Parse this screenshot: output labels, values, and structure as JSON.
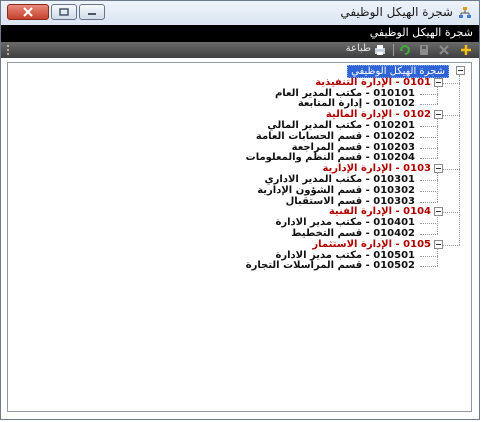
{
  "window": {
    "title": "شجرة الهيكل الوظيفي",
    "icon": "org-tree-icon"
  },
  "header": {
    "title": "شجرة الهيكل الوظيفي"
  },
  "toolbar": {
    "add_icon": "plus-icon",
    "delete_icon": "close-icon",
    "save_icon": "disk-icon",
    "refresh_icon": "refresh-icon",
    "print_icon": "printer-icon",
    "print_label": "طباعة"
  },
  "tree": {
    "root": "شجرة الهيكل الوظيفي",
    "departments": [
      {
        "label": "0101 - الإدارة التنفيذية",
        "items": [
          "010101 - مكتب المدير العام",
          "010102 - إدارة المتابعة"
        ]
      },
      {
        "label": "0102 - الإدارة المالية",
        "items": [
          "010201 - مكتب المدير المالي",
          "010202 - قسم الحسابات العامة",
          "010203 - قسم المراجعة",
          "010204 - قسم النظم والمعلومات"
        ]
      },
      {
        "label": "0103 - الإدارة الإدارية",
        "items": [
          "010301 - مكتب المدير الاداري",
          "010302 - قسم الشؤون الإدارية",
          "010303 - قسم الاستقبال"
        ]
      },
      {
        "label": "0104 - الإدارة الفنية",
        "items": [
          "010401 - مكتب مدير الادارة",
          "010402 - قسم التخطيط"
        ]
      },
      {
        "label": "0105 - الإدارة الاستثمار",
        "items": [
          "010501 - مكتب مدير الادارة",
          "010502 - قسم المراسلات التجارة"
        ]
      }
    ]
  },
  "colors": {
    "department_text": "#b00000",
    "item_text": "#111111",
    "root_highlight": "#2f64d6",
    "header_bar": "#000000",
    "toolbar": "#4f4f4f"
  }
}
